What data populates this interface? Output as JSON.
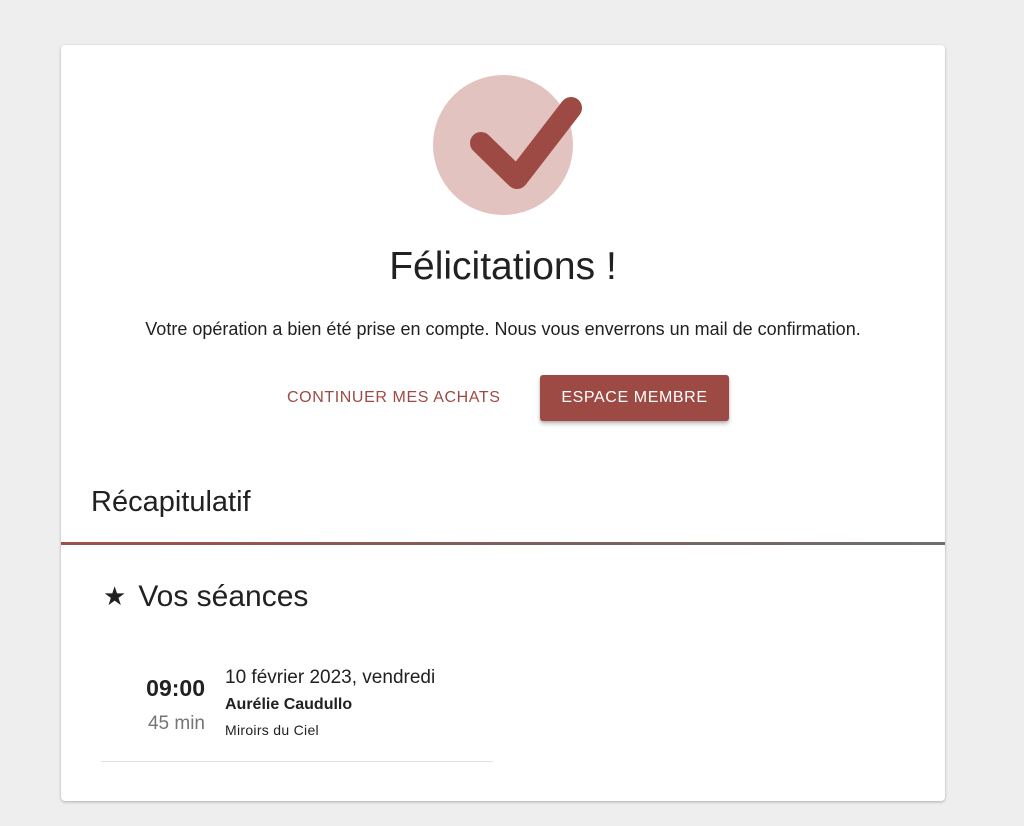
{
  "confirmation": {
    "icon": "check-icon",
    "title": "Félicitations !",
    "message": "Votre opération a bien été prise en compte. Nous vous enverrons un mail de confirmation."
  },
  "actions": {
    "continue_label": "CONTINUER MES ACHATS",
    "member_label": "ESPACE MEMBRE"
  },
  "summary": {
    "title": "Récapitulatif",
    "sessions_icon": "star-icon",
    "sessions_title": "Vos séances",
    "sessions": [
      {
        "time": "09:00",
        "duration": "45 min",
        "date": "10 février 2023, vendredi",
        "person": "Aurélie Caudullo",
        "place": "Miroirs du Ciel"
      }
    ]
  },
  "colors": {
    "accent": "#9e4a44",
    "check_circle": "#e2c3bf",
    "background": "#eeeeee",
    "card": "#ffffff"
  }
}
